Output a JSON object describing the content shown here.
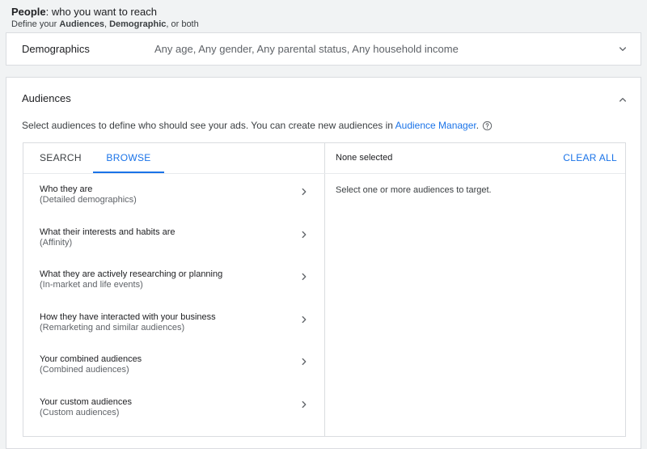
{
  "header": {
    "title_bold": "People",
    "title_rest": ": who you want to reach",
    "sub_prefix": "Define your ",
    "sub_b1": "Audiences",
    "sub_sep": ", ",
    "sub_b2": "Demographic",
    "sub_suffix": ", or both"
  },
  "demographics": {
    "label": "Demographics",
    "summary": "Any age, Any gender, Any parental status, Any household income",
    "chevron_icon": "chevron-down-icon"
  },
  "audiences": {
    "title": "Audiences",
    "chevron_icon": "chevron-up-icon",
    "description": "Select audiences to define who should see your ads. You can create new audiences in ",
    "link_text": "Audience Manager",
    "description_end": ".",
    "help_icon": "help-icon",
    "tabs": [
      {
        "label": "SEARCH",
        "active": false
      },
      {
        "label": "BROWSE",
        "active": true
      }
    ],
    "items": [
      {
        "title": "Who they are",
        "subtitle": "(Detailed demographics)"
      },
      {
        "title": "What their interests and habits are",
        "subtitle": "(Affinity)"
      },
      {
        "title": "What they are actively researching or planning",
        "subtitle": "(In-market and life events)"
      },
      {
        "title": "How they have interacted with your business",
        "subtitle": "(Remarketing and similar audiences)"
      },
      {
        "title": "Your combined audiences",
        "subtitle": "(Combined audiences)"
      },
      {
        "title": "Your custom audiences",
        "subtitle": "(Custom audiences)"
      }
    ],
    "selection": {
      "none_selected": "None selected",
      "clear_all": "CLEAR ALL",
      "hint": "Select one or more audiences to target."
    }
  },
  "colors": {
    "accent": "#1a73e8",
    "background": "#f1f3f4",
    "border": "#dadce0"
  }
}
